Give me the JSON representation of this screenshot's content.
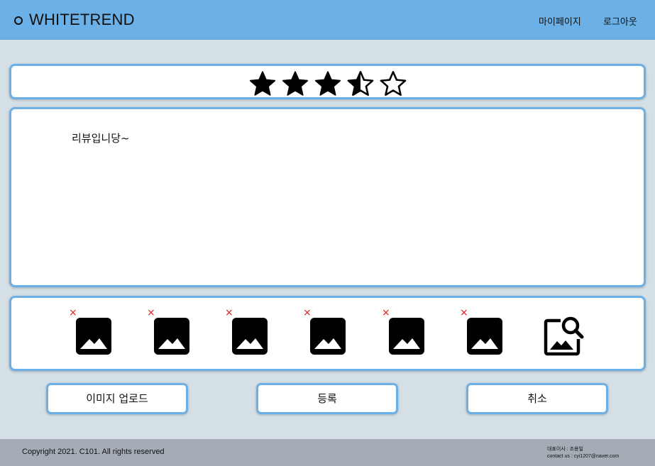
{
  "header": {
    "title": "WHITETREND",
    "nav": {
      "mypage": "마이페이지",
      "logout": "로그아웃"
    }
  },
  "rating": {
    "value": 3.5,
    "max": 5
  },
  "review": {
    "text": "리뷰입니당~"
  },
  "images": {
    "thumbnails": [
      {
        "remove_label": "×",
        "icon": "image-icon"
      },
      {
        "remove_label": "×",
        "icon": "image-icon"
      },
      {
        "remove_label": "×",
        "icon": "image-icon"
      },
      {
        "remove_label": "×",
        "icon": "image-icon"
      },
      {
        "remove_label": "×",
        "icon": "image-icon"
      },
      {
        "remove_label": "×",
        "icon": "image-icon"
      }
    ],
    "add_icon": "image-search-icon"
  },
  "buttons": {
    "upload": "이미지 업로드",
    "submit": "등록",
    "cancel": "취소"
  },
  "footer": {
    "copyright": "Copyright 2021. C101. All rights reserved",
    "ceo": "대표이사 : 조용일",
    "contact": "contact us : cyi1207@naver.com"
  },
  "colors": {
    "accent": "#6bb0e6",
    "background": "#d4dfe6",
    "footer": "#a4acb5",
    "remove": "#e21a1a"
  }
}
